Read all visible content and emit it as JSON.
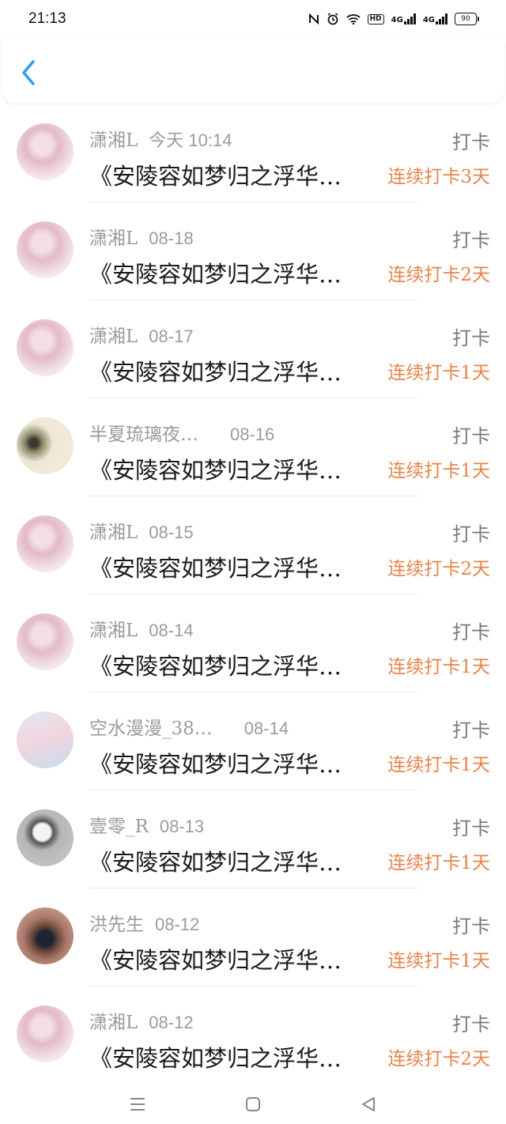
{
  "status_bar": {
    "time": "21:13",
    "net1": "4G",
    "net2": "4G",
    "hd": "HD",
    "battery": "90"
  },
  "header": {
    "back_icon": "chevron-left-icon",
    "accent_color": "#2a9df4"
  },
  "entries": [
    {
      "name": "潇湘L",
      "date": "今天 10:14",
      "title": "《安陵容如梦归之浮华…",
      "action": "打卡",
      "streak": "连续打卡3天",
      "avatar": "avatar-girl"
    },
    {
      "name": "潇湘L",
      "date": "08-18",
      "title": "《安陵容如梦归之浮华…",
      "action": "打卡",
      "streak": "连续打卡2天",
      "avatar": "avatar-girl"
    },
    {
      "name": "潇湘L",
      "date": "08-17",
      "title": "《安陵容如梦归之浮华…",
      "action": "打卡",
      "streak": "连续打卡1天",
      "avatar": "avatar-girl"
    },
    {
      "name": "半夏琉璃夜…",
      "date": "08-16",
      "title": "《安陵容如梦归之浮华…",
      "action": "打卡",
      "streak": "连续打卡1天",
      "avatar": "avatar-ink-painting"
    },
    {
      "name": "潇湘L",
      "date": "08-15",
      "title": "《安陵容如梦归之浮华…",
      "action": "打卡",
      "streak": "连续打卡2天",
      "avatar": "avatar-girl"
    },
    {
      "name": "潇湘L",
      "date": "08-14",
      "title": "《安陵容如梦归之浮华…",
      "action": "打卡",
      "streak": "连续打卡1天",
      "avatar": "avatar-girl"
    },
    {
      "name": "空水漫漫_38…",
      "date": "08-14",
      "title": "《安陵容如梦归之浮华…",
      "action": "打卡",
      "streak": "连续打卡1天",
      "avatar": "avatar-pastel"
    },
    {
      "name": "壹零_R",
      "date": "08-13",
      "title": "《安陵容如梦归之浮华…",
      "action": "打卡",
      "streak": "连续打卡1天",
      "avatar": "avatar-cartoon"
    },
    {
      "name": "洪先生",
      "date": "08-12",
      "title": "《安陵容如梦归之浮华…",
      "action": "打卡",
      "streak": "连续打卡1天",
      "avatar": "avatar-boy"
    },
    {
      "name": "潇湘L",
      "date": "08-12",
      "title": "《安陵容如梦归之浮华…",
      "action": "打卡",
      "streak": "连续打卡2天",
      "avatar": "avatar-girl"
    }
  ],
  "colors": {
    "streak": "#e8834a",
    "meta": "#9b9b9b"
  },
  "nav_bar": {
    "menu_icon": "menu-icon",
    "home_icon": "home-square-icon",
    "back_icon": "back-triangle-icon"
  }
}
